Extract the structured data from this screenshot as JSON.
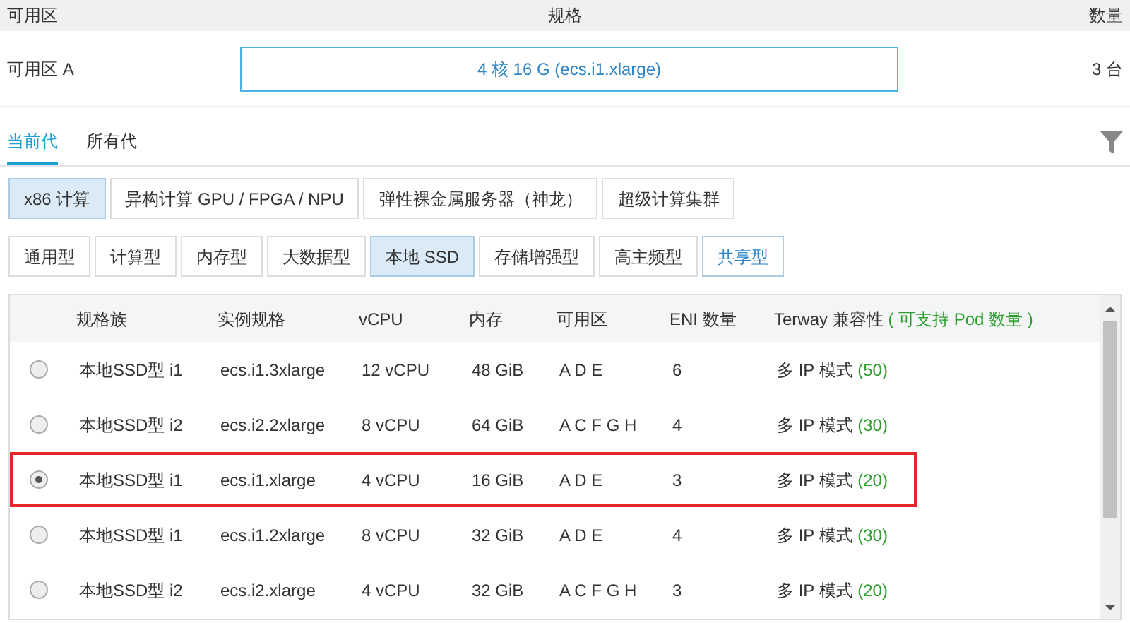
{
  "config_table": {
    "columns": [
      "可用区",
      "规格",
      "数量"
    ],
    "row": {
      "zone": "可用区 A",
      "spec": "4 核 16 G (ecs.i1.xlarge)",
      "count": "3 台"
    }
  },
  "generation_tabs": [
    {
      "label": "当前代",
      "selected": true
    },
    {
      "label": "所有代",
      "selected": false
    }
  ],
  "architecture_buttons": [
    {
      "label": "x86 计算",
      "selected": true
    },
    {
      "label": "异构计算 GPU / FPGA / NPU",
      "selected": false
    },
    {
      "label": "弹性裸金属服务器（神龙）",
      "selected": false
    },
    {
      "label": "超级计算集群",
      "selected": false
    }
  ],
  "type_buttons": [
    {
      "label": "通用型",
      "selected": false,
      "highlighted": false
    },
    {
      "label": "计算型",
      "selected": false,
      "highlighted": false
    },
    {
      "label": "内存型",
      "selected": false,
      "highlighted": false
    },
    {
      "label": "大数据型",
      "selected": false,
      "highlighted": false
    },
    {
      "label": "本地 SSD",
      "selected": true,
      "highlighted": false
    },
    {
      "label": "存储增强型",
      "selected": false,
      "highlighted": false
    },
    {
      "label": "高主频型",
      "selected": false,
      "highlighted": false
    },
    {
      "label": "共享型",
      "selected": false,
      "highlighted": true
    }
  ],
  "instance_table": {
    "columns": [
      "规格族",
      "实例规格",
      "vCPU",
      "内存",
      "可用区",
      "ENI 数量"
    ],
    "terway_header": {
      "label": "Terway 兼容性",
      "note": "( 可支持 Pod 数量 )"
    },
    "rows": [
      {
        "family": "本地SSD型 i1",
        "spec": "ecs.i1.3xlarge",
        "vcpu": "12 vCPU",
        "memory": "48 GiB",
        "zones": "A D E",
        "eni": "6",
        "mode": "多 IP 模式",
        "pods": "(50)",
        "selected": false
      },
      {
        "family": "本地SSD型 i2",
        "spec": "ecs.i2.2xlarge",
        "vcpu": "8 vCPU",
        "memory": "64 GiB",
        "zones": "A C F G H",
        "eni": "4",
        "mode": "多 IP 模式",
        "pods": "(30)",
        "selected": false
      },
      {
        "family": "本地SSD型 i1",
        "spec": "ecs.i1.xlarge",
        "vcpu": "4 vCPU",
        "memory": "16 GiB",
        "zones": "A D E",
        "eni": "3",
        "mode": "多 IP 模式",
        "pods": "(20)",
        "selected": true
      },
      {
        "family": "本地SSD型 i1",
        "spec": "ecs.i1.2xlarge",
        "vcpu": "8 vCPU",
        "memory": "32 GiB",
        "zones": "A D E",
        "eni": "4",
        "mode": "多 IP 模式",
        "pods": "(30)",
        "selected": false
      },
      {
        "family": "本地SSD型 i2",
        "spec": "ecs.i2.xlarge",
        "vcpu": "4 vCPU",
        "memory": "32 GiB",
        "zones": "A C F G H",
        "eni": "3",
        "mode": "多 IP 模式",
        "pods": "(20)",
        "selected": false
      }
    ]
  }
}
